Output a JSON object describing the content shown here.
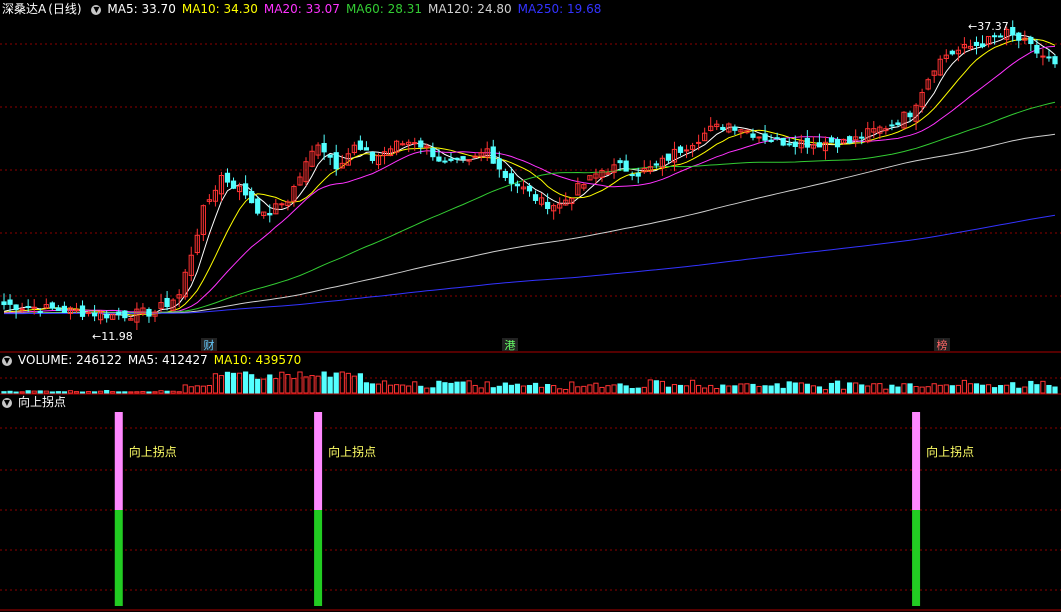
{
  "title": "深桑达A",
  "period": "(日线)",
  "ma_labels": [
    {
      "text": "MA5: 33.70",
      "color": "#ffffff"
    },
    {
      "text": "MA10: 34.30",
      "color": "#ffff00"
    },
    {
      "text": "MA20: 33.07",
      "color": "#ff33ff"
    },
    {
      "text": "MA60: 28.31",
      "color": "#33cc33"
    },
    {
      "text": "MA120: 24.80",
      "color": "#d0d0d0"
    },
    {
      "text": "MA250: 19.68",
      "color": "#3333ff"
    }
  ],
  "volume_labels": [
    {
      "text": "VOLUME: 246122",
      "color": "#ffffff"
    },
    {
      "text": "MA5: 412427",
      "color": "#ffffff"
    },
    {
      "text": "MA10: 439570",
      "color": "#ffff00"
    }
  ],
  "indicator_title": "向上拐点",
  "signal_label": "向上拐点",
  "high_marker": "37.37",
  "low_marker": "11.98",
  "news_tags": [
    {
      "text": "财",
      "color": "#66ccff"
    },
    {
      "text": "港",
      "color": "#66ff66"
    },
    {
      "text": "榜",
      "color": "#ff6666"
    }
  ],
  "colors": {
    "up": "#ff3333",
    "down": "#54ffff",
    "grid": "#8b0000",
    "sep": "#aa0000"
  },
  "chart_data": {
    "type": "candlestick",
    "n_bars": 175,
    "y_range_approx": [
      10.5,
      38.5
    ],
    "anchors": [
      [
        0,
        13.4
      ],
      [
        18,
        12.5
      ],
      [
        22,
        12.6
      ],
      [
        25,
        12.8
      ],
      [
        29,
        14.2
      ],
      [
        33,
        21.5
      ],
      [
        36,
        24.5
      ],
      [
        40,
        23
      ],
      [
        43,
        21
      ],
      [
        47,
        22.5
      ],
      [
        52,
        27.5
      ],
      [
        55,
        25.5
      ],
      [
        58,
        27
      ],
      [
        61,
        26
      ],
      [
        65,
        27.2
      ],
      [
        68,
        27.6
      ],
      [
        71,
        26.5
      ],
      [
        73,
        25.5
      ],
      [
        77,
        25.6
      ],
      [
        80,
        26.8
      ],
      [
        83,
        24.5
      ],
      [
        87,
        23
      ],
      [
        89,
        22.2
      ],
      [
        92,
        22
      ],
      [
        95,
        23.4
      ],
      [
        99,
        25
      ],
      [
        102,
        25.3
      ],
      [
        105,
        24.8
      ],
      [
        108,
        25.3
      ],
      [
        111,
        26.5
      ],
      [
        114,
        27.5
      ],
      [
        117,
        28.5
      ],
      [
        120,
        29
      ],
      [
        122,
        28.7
      ],
      [
        125,
        28
      ],
      [
        128,
        27.5
      ],
      [
        131,
        27.5
      ],
      [
        134,
        27.3
      ],
      [
        137,
        27.5
      ],
      [
        140,
        27.4
      ],
      [
        143,
        28.2
      ],
      [
        147,
        29
      ],
      [
        150,
        30
      ],
      [
        152,
        32
      ],
      [
        154,
        34
      ],
      [
        156,
        35
      ],
      [
        159,
        35.5
      ],
      [
        163,
        36.2
      ],
      [
        166,
        36.8
      ],
      [
        169,
        36
      ],
      [
        171,
        35.2
      ],
      [
        174,
        34.2
      ]
    ],
    "ma_periods": [
      5,
      10,
      20,
      60,
      120,
      250
    ],
    "ma_colors": [
      "#ffffff",
      "#ffff00",
      "#ff33ff",
      "#33cc33",
      "#d0d0d0",
      "#3333ff"
    ],
    "ma_current": [
      33.7,
      34.3,
      33.07,
      28.31,
      24.8,
      19.68
    ],
    "volume": {
      "last": 246122,
      "ma5": 412427,
      "ma10": 439570
    },
    "signals": [
      {
        "bar": 19,
        "label": "向上拐点"
      },
      {
        "bar": 52,
        "label": "向上拐点"
      },
      {
        "bar": 151,
        "label": "向上拐点"
      }
    ]
  }
}
